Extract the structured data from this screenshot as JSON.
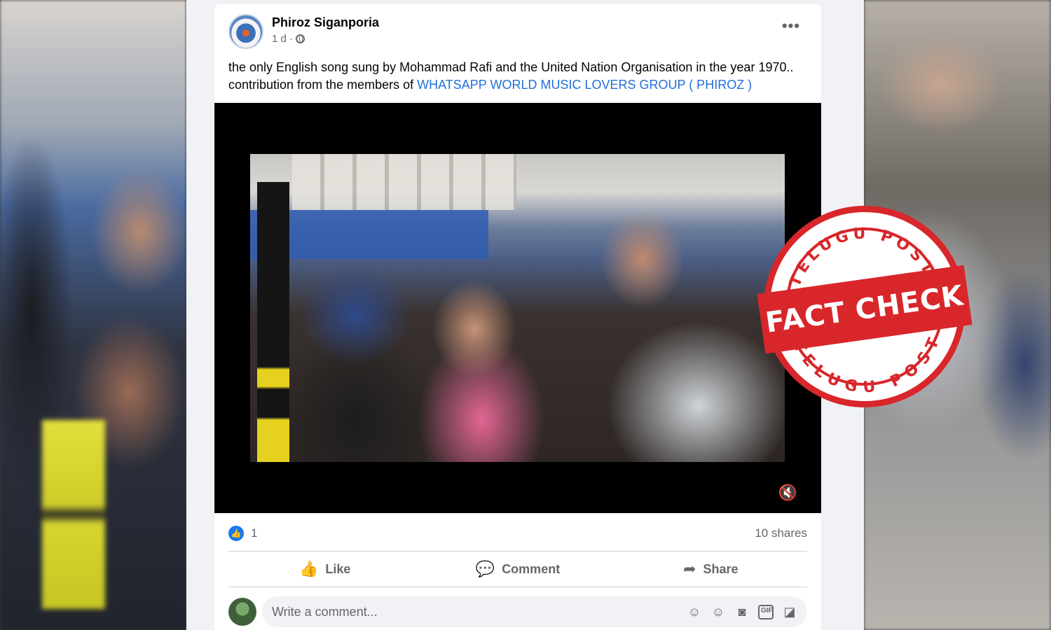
{
  "post": {
    "author": "Phiroz Siganporia",
    "time": "1 d",
    "more_label": "•••",
    "text": "the only English song sung by Mohammad Rafi and the United Nation Organisation in the year 1970.. contribution from the members of ",
    "link": "WHATSAPP WORLD MUSIC LOVERS GROUP ( PHIROZ )"
  },
  "stats": {
    "reactions": "1",
    "shares": "10 shares"
  },
  "actions": {
    "like": "Like",
    "comment": "Comment",
    "share": "Share"
  },
  "comment": {
    "placeholder": "Write a comment..."
  },
  "stamp": {
    "top": "TELUGU POST",
    "center": "FACT CHECK",
    "bottom": "TELUGU POST",
    "color": "#d8262a"
  },
  "icons": {
    "more": "more-options-icon",
    "privacy": "globe-icon",
    "mute": "mute-icon",
    "like": "thumbs-up-icon",
    "comment": "comment-bubble-icon",
    "share": "share-arrow-icon",
    "sticker": "sticker-icon",
    "emoji": "emoji-icon",
    "camera": "camera-icon",
    "gif": "gif-icon",
    "avatar_sticker": "avatar-sticker-icon"
  }
}
